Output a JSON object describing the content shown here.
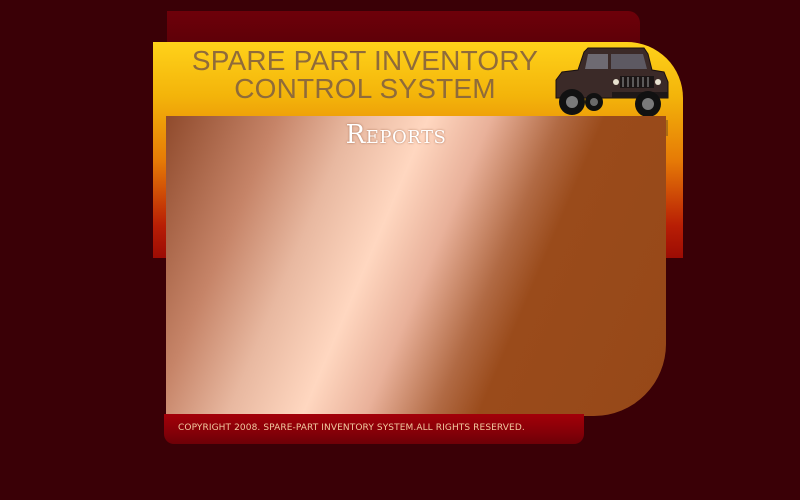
{
  "header": {
    "title_line1": "SPARE PART INVENTORY",
    "title_line2": "CONTROL SYSTEM",
    "vehicle_image": "suv-truck-icon"
  },
  "main": {
    "heading": "Reports"
  },
  "footer": {
    "copyright": "COPYRIGHT 2008. SPARE-PART INVENTORY SYSTEM.ALL RIGHTS  RESERVED."
  },
  "colors": {
    "background": "#3a0006",
    "header_gradient_top": "#ffd21a",
    "header_gradient_bottom": "#9c0c04",
    "title_text": "#8f6b3a",
    "footer_bar": "#8a0008",
    "footer_text": "#f2c9a0"
  }
}
